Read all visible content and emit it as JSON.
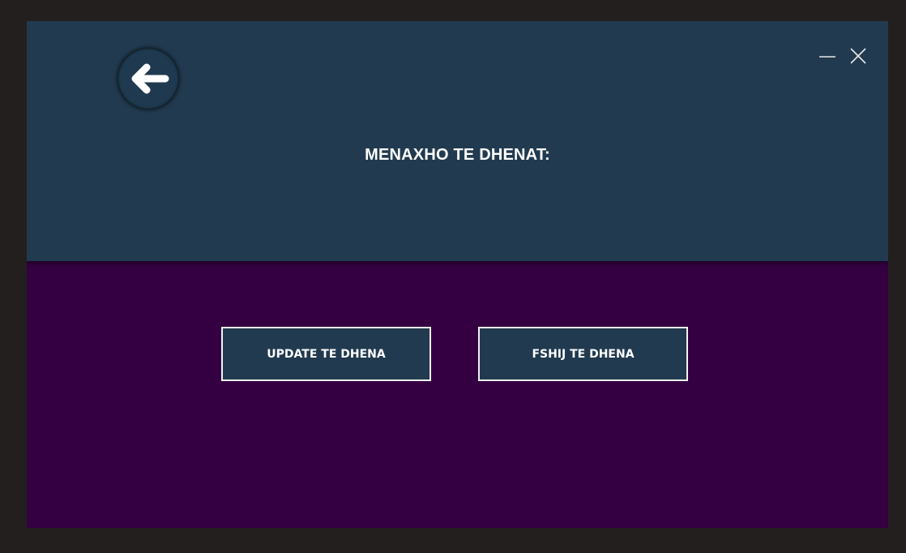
{
  "header": {
    "title": "MENAXHO TE DHENAT:",
    "back_icon": "arrow-left-icon",
    "minimize_icon": "minimize-icon",
    "close_icon": "close-icon",
    "background": "#213a4f"
  },
  "content": {
    "background": "#350042",
    "buttons": [
      {
        "label": "UPDATE TE DHENA"
      },
      {
        "label": "FSHIJ TE DHENA"
      }
    ]
  }
}
